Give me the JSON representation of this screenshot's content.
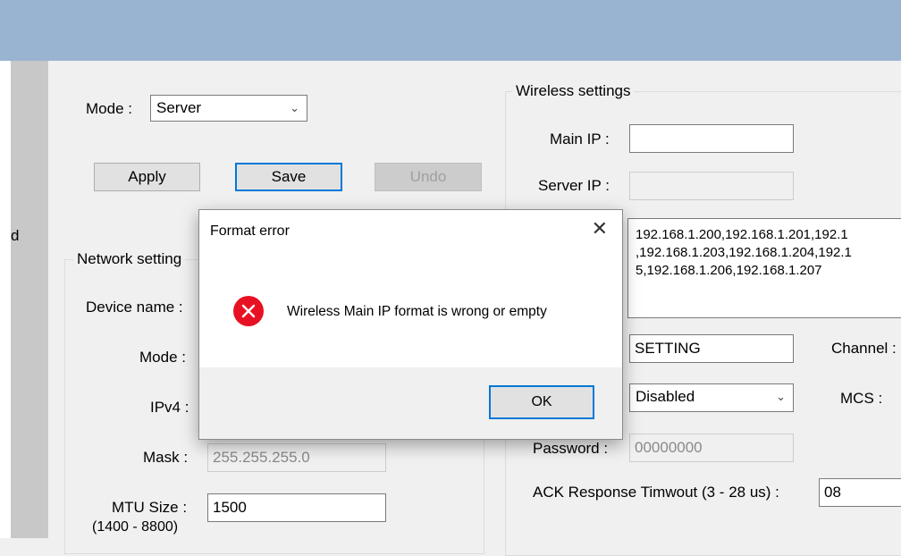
{
  "left_panel": {
    "fragment": "d"
  },
  "top": {
    "mode_label": "Mode :",
    "mode_value": "Server",
    "apply": "Apply",
    "save": "Save",
    "undo": "Undo"
  },
  "network": {
    "group_label": "Network setting",
    "device_name_label": "Device name :",
    "mode_label": "Mode :",
    "ipv4_label": "IPv4 :",
    "mask_label": "Mask :",
    "mask_value": "255.255.255.0",
    "mtu_label": "MTU Size :",
    "mtu_range": "(1400 - 8800)",
    "mtu_value": "1500"
  },
  "wireless": {
    "group_label": "Wireless settings",
    "main_ip_label": "Main IP :",
    "main_ip_value": "",
    "server_ip_label": "Server IP :",
    "server_ip_value": "",
    "ip_list_lines": [
      "192.168.1.200,192.168.1.201,192.1",
      ",192.168.1.203,192.168.1.204,192.1",
      "5,192.168.1.206,192.168.1.207"
    ],
    "ssid_value": "SETTING",
    "channel_label": "Channel :",
    "security_value": "Disabled",
    "mcs_label": "MCS :",
    "password_label": "Password :",
    "password_value": "00000000",
    "ack_label": "ACK Response Timwout (3 - 28 us) :",
    "ack_value": "08"
  },
  "dialog": {
    "title": "Format error",
    "close": "✕",
    "message": "Wireless Main IP format is wrong or empty",
    "ok": "OK"
  },
  "colors": {
    "titlebar": "#99b4d1",
    "focus_border": "#0078d7",
    "error_icon": "#e81123"
  }
}
